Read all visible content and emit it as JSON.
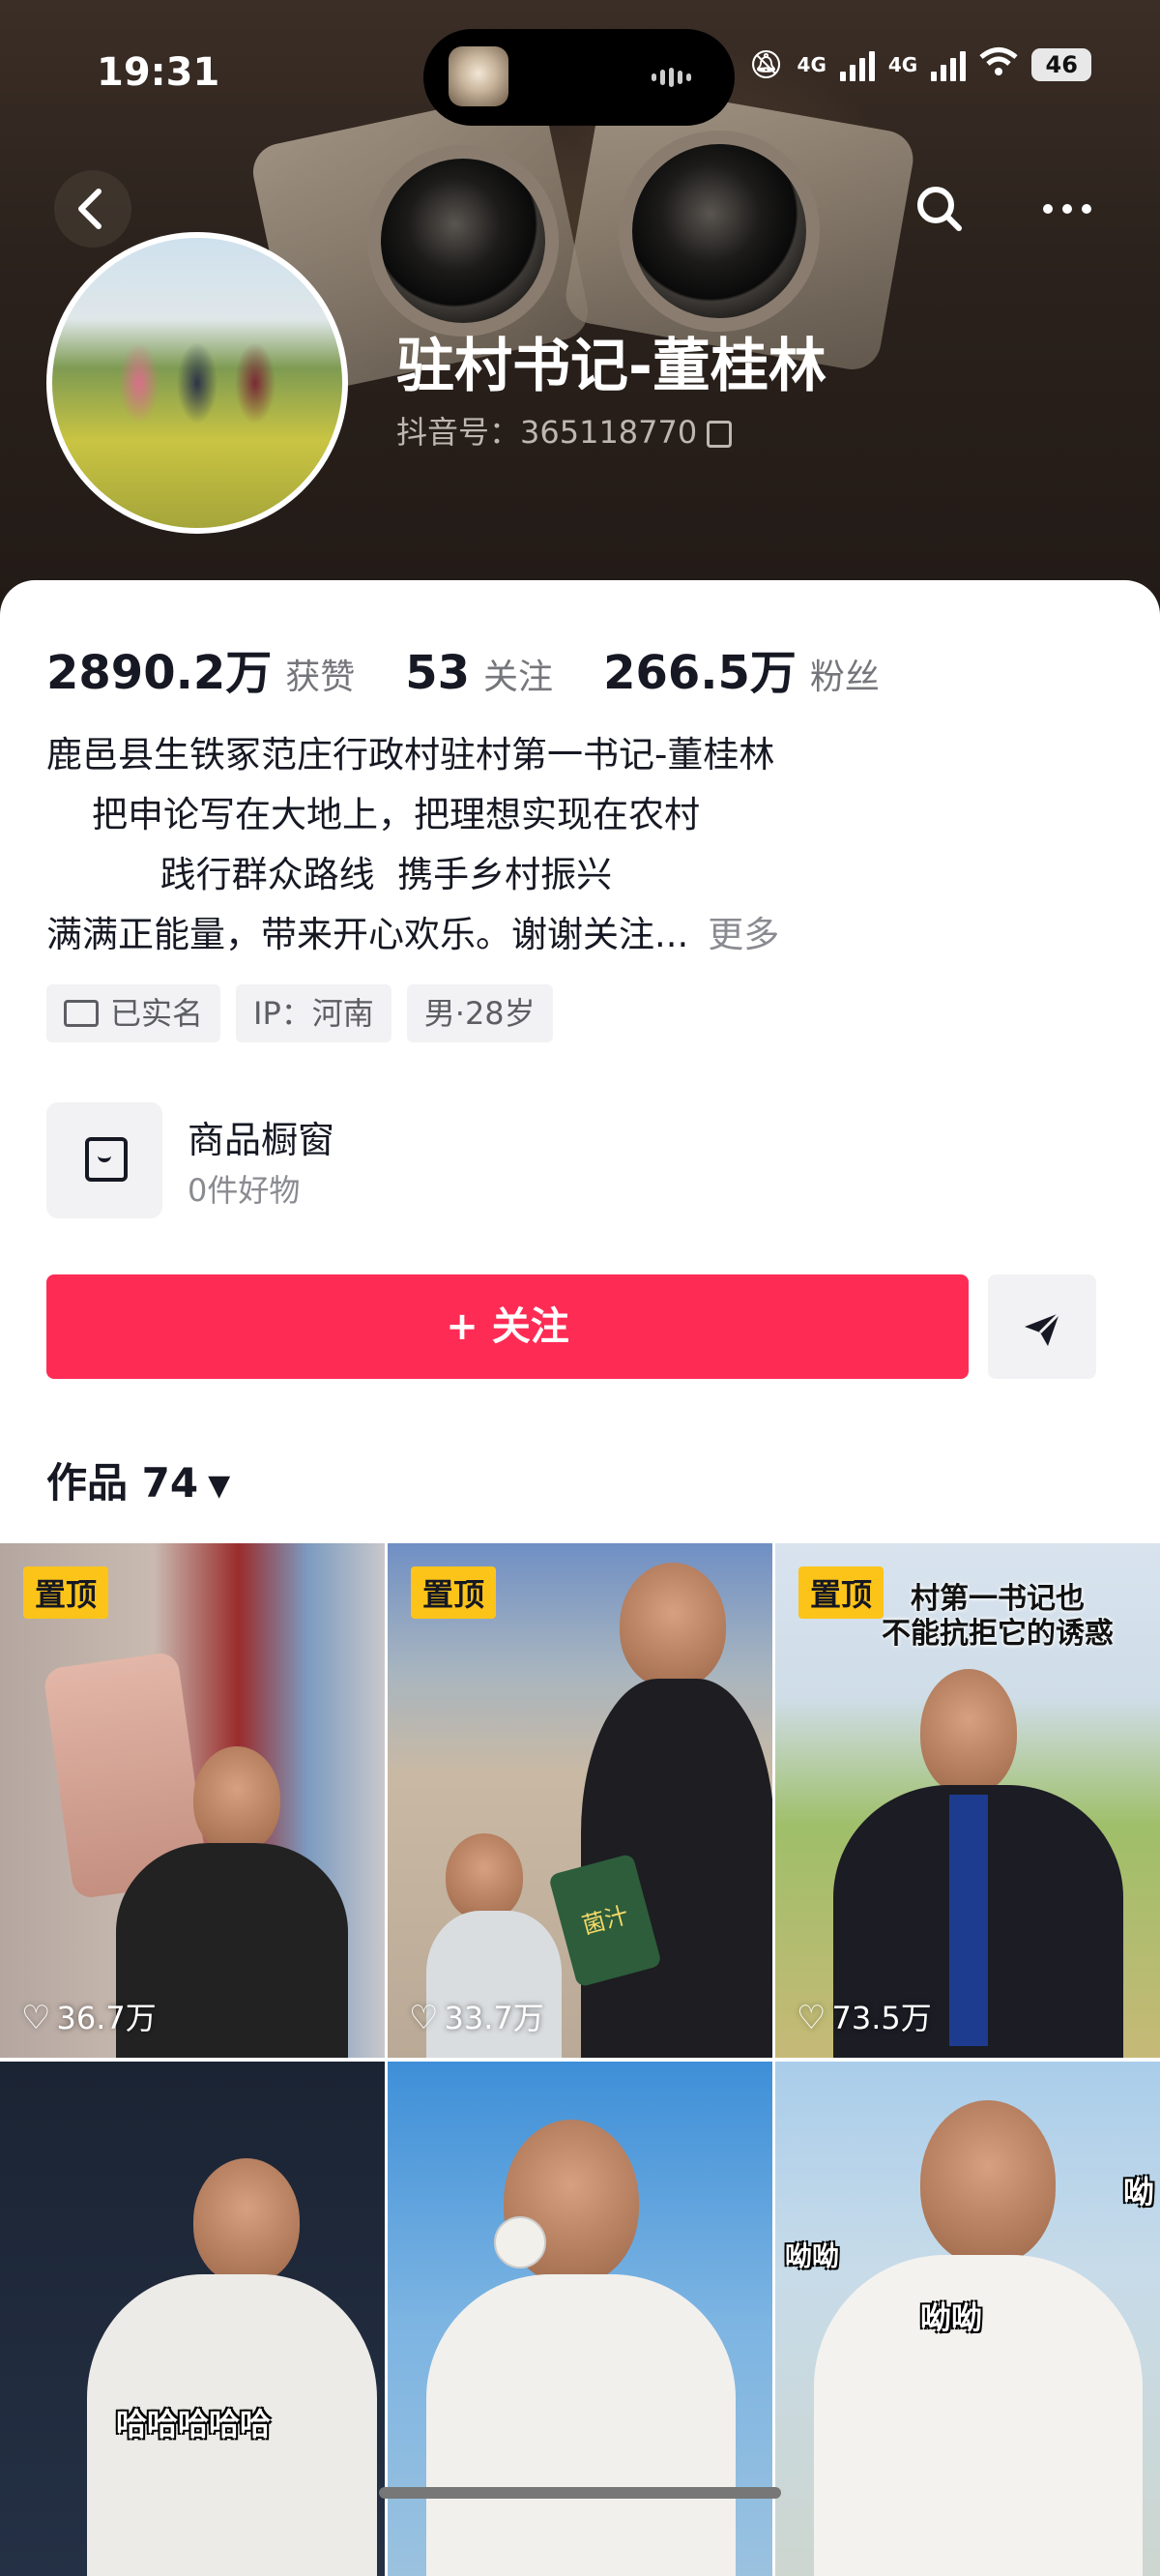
{
  "status_bar": {
    "time": "19:31",
    "network_1": "4G",
    "network_2": "4G",
    "battery": "46"
  },
  "nav": {
    "back_icon": "chevron-left-icon",
    "search_icon": "search-icon",
    "more_icon": "more-dots-icon"
  },
  "profile": {
    "name": "驻村书记-董桂林",
    "douyin_id": "抖音号：365118770",
    "stats": [
      {
        "value": "2890.2万",
        "label": "获赞"
      },
      {
        "value": "53",
        "label": "关注"
      },
      {
        "value": "266.5万",
        "label": "粉丝"
      }
    ],
    "bio_lines": [
      "鹿邑县生铁冢范庄行政村驻村第一书记-董桂林",
      "    把申论写在大地上，把理想实现在农村",
      "          践行群众路线  携手乡村振兴",
      "满满正能量，带来开心欢乐。谢谢关注..."
    ],
    "bio_more": "更多",
    "tags": [
      "已实名",
      "IP：河南",
      "男·28岁"
    ]
  },
  "shop": {
    "title": "商品橱窗",
    "subtitle": "0件好物"
  },
  "actions": {
    "follow_label": "+ 关注",
    "share_icon": "paper-plane-icon"
  },
  "works": {
    "tab_label": "作品 74",
    "pinned_label": "置顶",
    "items": [
      {
        "likes": "36.7万",
        "pinned": true
      },
      {
        "likes": "33.7万",
        "pinned": true,
        "overlay": "菌汁"
      },
      {
        "likes": "73.5万",
        "pinned": true,
        "overlay": "村第一书记也\n不能抗拒它的诱惑"
      },
      {
        "overlay": "哈哈哈哈哈"
      },
      {},
      {
        "overlay": "呦呦",
        "overlay2": "呦呦",
        "overlay3": "呦"
      }
    ]
  },
  "colors": {
    "follow_button": "#fe2c55",
    "pin_badge": "#fcc419"
  }
}
